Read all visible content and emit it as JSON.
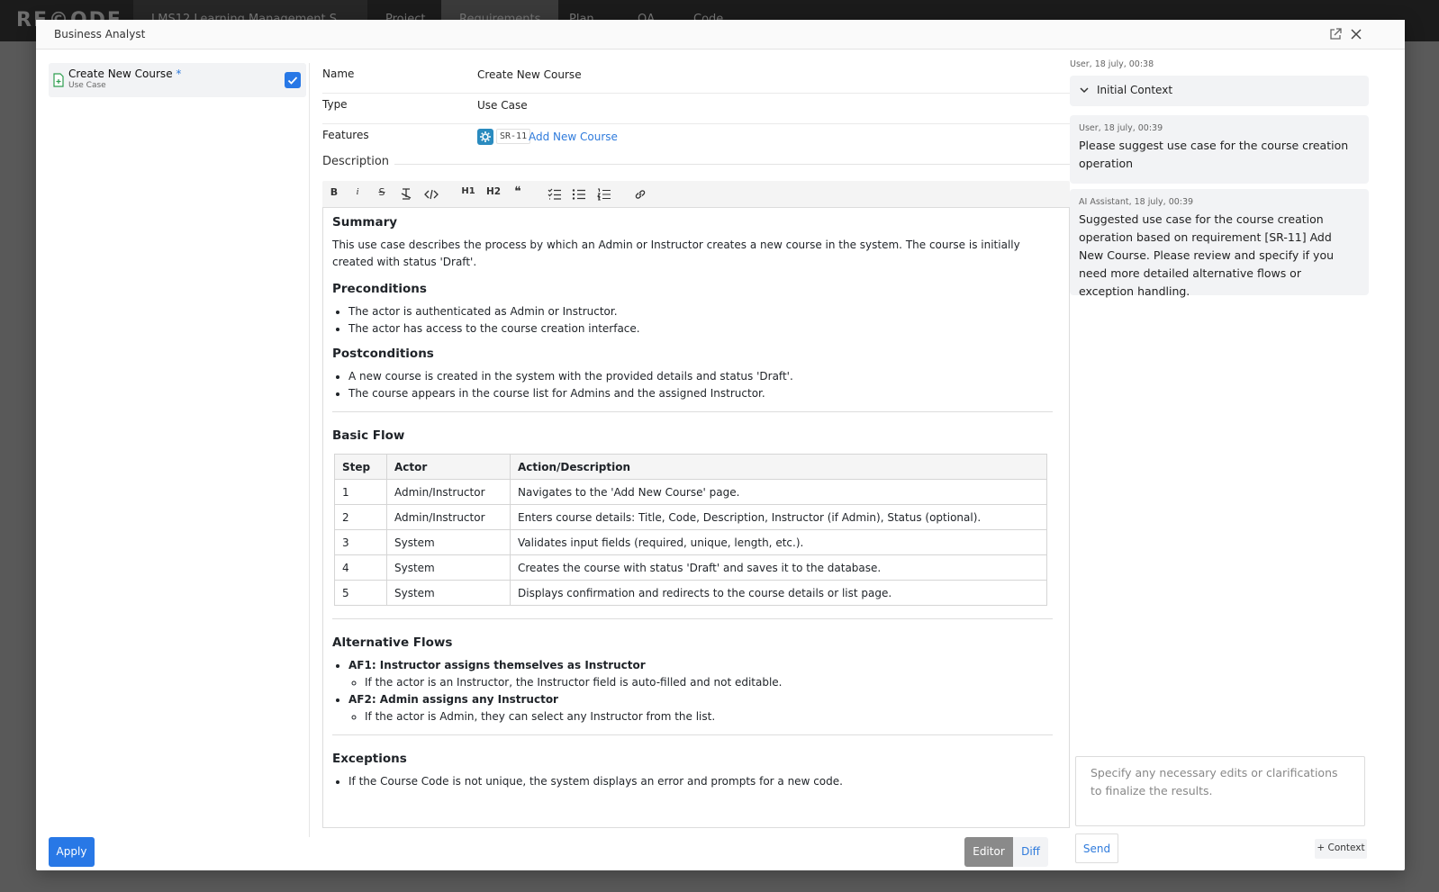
{
  "background": {
    "logo": "RE©ODE",
    "tabs": [
      "LMS12 Learning Management S...",
      "Project",
      "Requirements",
      "Plan",
      "QA",
      "Code"
    ]
  },
  "modal": {
    "title": "Business Analyst",
    "icons": [
      "open-external-icon",
      "close-icon"
    ]
  },
  "left": {
    "item": {
      "name": "Create New Course",
      "marker": "*",
      "type": "Use Case",
      "checked": true
    }
  },
  "form": {
    "name_label": "Name",
    "name_value": "Create New Course",
    "type_label": "Type",
    "type_value": "Use Case",
    "features_label": "Features",
    "feature_id": "SR-11",
    "feature_name": "Add New Course",
    "description_label": "Description"
  },
  "toolbar": {
    "bold": "B",
    "italic": "i",
    "strike": "S",
    "h1": "H1",
    "h2": "H2",
    "quote": "❝"
  },
  "doc": {
    "summary_h": "Summary",
    "summary_p": "This use case describes the process by which an Admin or Instructor creates a new course in the system. The course is initially created with status 'Draft'.",
    "pre_h": "Preconditions",
    "pre": [
      "The actor is authenticated as Admin or Instructor.",
      "The actor has access to the course creation interface."
    ],
    "post_h": "Postconditions",
    "post": [
      "A new course is created in the system with the provided details and status 'Draft'.",
      "The course appears in the course list for Admins and the assigned Instructor."
    ],
    "flow_h": "Basic Flow",
    "table": {
      "headers": [
        "Step",
        "Actor",
        "Action/Description"
      ],
      "rows": [
        [
          "1",
          "Admin/Instructor",
          "Navigates to the 'Add New Course' page."
        ],
        [
          "2",
          "Admin/Instructor",
          "Enters course details: Title, Code, Description, Instructor (if Admin), Status (optional)."
        ],
        [
          "3",
          "System",
          "Validates input fields (required, unique, length, etc.)."
        ],
        [
          "4",
          "System",
          "Creates the course with status 'Draft' and saves it to the database."
        ],
        [
          "5",
          "System",
          "Displays confirmation and redirects to the course details or list page."
        ]
      ]
    },
    "alt_h": "Alternative Flows",
    "alt1_t": "AF1: Instructor assigns themselves as Instructor",
    "alt1_d": "If the actor is an Instructor, the Instructor field is auto-filled and not editable.",
    "alt2_t": "AF2: Admin assigns any Instructor",
    "alt2_d": "If the actor is Admin, they can select any Instructor from the list.",
    "exc_h": "Exceptions",
    "exc1": "If the Course Code is not unique, the system displays an error and prompts for a new code."
  },
  "bottom": {
    "apply": "Apply",
    "editor": "Editor",
    "diff": "Diff"
  },
  "chat": {
    "ctx_ts": "User, 18 july, 00:38",
    "ctx_title": "Initial Context",
    "m1_ts": "User, 18 july, 00:39",
    "m1": "Please suggest use case for the course creation operation",
    "m2_ts": "AI Assistant, 18 july, 00:39",
    "m2": "Suggested use case for the course creation operation based on requirement [SR-11] Add New Course. Please review and specify if you need more detailed alternative flows or exception handling.",
    "placeholder": "Specify any necessary edits or clarifications to finalize the results.",
    "send": "Send",
    "context_btn": "+ Context"
  },
  "colors": {
    "primary": "#2878e6",
    "link": "#2f7bdc",
    "feature_icon": "#2a8bbf",
    "panel_bg": "#f2f3f5"
  }
}
